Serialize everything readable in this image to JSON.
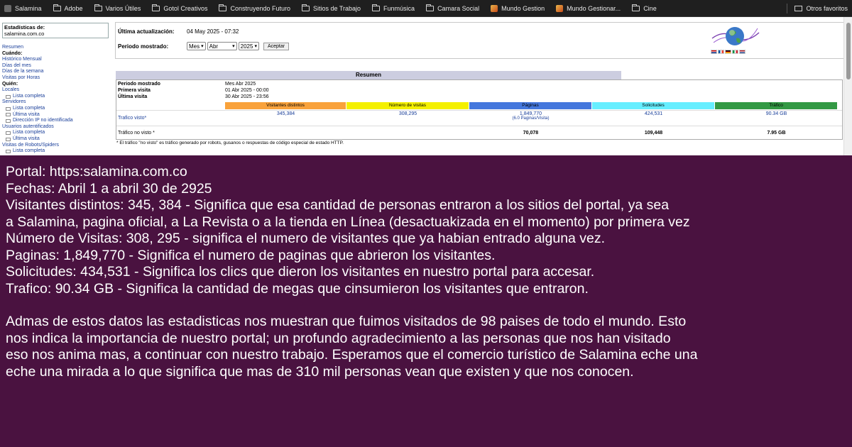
{
  "bookmarks": {
    "items": [
      {
        "label": "Salamina",
        "icon": "site-favicon"
      },
      {
        "label": "Adobe",
        "icon": "folder-icon"
      },
      {
        "label": "Varios Útiles",
        "icon": "folder-icon"
      },
      {
        "label": "Gotol Creativos",
        "icon": "folder-icon"
      },
      {
        "label": "Construyendo Futuro",
        "icon": "folder-icon"
      },
      {
        "label": "Sitios de Trabajo",
        "icon": "folder-icon"
      },
      {
        "label": "Funmúsica",
        "icon": "folder-icon"
      },
      {
        "label": "Camara Social",
        "icon": "folder-icon"
      },
      {
        "label": "Mundo Gestion",
        "icon": "site-favicon"
      },
      {
        "label": "Mundo Gestionar...",
        "icon": "site-favicon"
      },
      {
        "label": "Cine",
        "icon": "folder-icon"
      }
    ],
    "other": "Otros favoritos"
  },
  "sidebar": {
    "site_title": "Estadísticas de:",
    "site_name": "salamina.com.co",
    "resumen": "Resumen",
    "cuando": "Cuándo:",
    "historico": "Histórico Mensual",
    "dias_mes": "Días del mes",
    "dias_semana": "Días de la semana",
    "visitas_horas": "Visitas por Horas",
    "quien": "Quién:",
    "locales": "Locales",
    "lista_completa": "Lista completa",
    "servidores": "Servidores",
    "ultima_visita": "Última visita",
    "ip_no_id": "Dirección IP no identificada",
    "usuarios_aut": "Usuarios autentificados",
    "robots": "Visitas de Robots/Spiders"
  },
  "form": {
    "last_update_label": "Última actualización:",
    "last_update_value": "04 May 2025 - 07:32",
    "period_label": "Periodo mostrado:",
    "type_value": "Mes",
    "month_value": "Abr",
    "year_value": "2025",
    "accept": "Aceptar"
  },
  "stats": {
    "heading": "Resumen",
    "periodo_label": "Periodo mostrado",
    "periodo_value": "Mes Abr 2025",
    "primera_label": "Primera visita",
    "primera_value": "01 Abr 2025 - 00:00",
    "ultima_label": "Última visita",
    "ultima_value": "30 Abr 2025 - 23:56",
    "columns": [
      {
        "label": "Visitantes distintos",
        "color": "#f9a23b"
      },
      {
        "label": "Número de visitas",
        "color": "#f4f000"
      },
      {
        "label": "Páginas",
        "color": "#4477dd"
      },
      {
        "label": "Solicitudes",
        "color": "#66eeff"
      },
      {
        "label": "Tráfico",
        "color": "#339944"
      }
    ],
    "visto_label": "Trafico visto*",
    "visto": [
      "345,384",
      "308,295",
      "1,849,770",
      "424,531",
      "90.34 GB"
    ],
    "visto_note": "(6.0 Paginas/Visita)",
    "no_visto_label": "Tráfico no visto *",
    "no_visto": [
      "",
      "",
      "70,078",
      "109,448",
      "7.95 GB"
    ],
    "footnote": "* El tráfico \"no visto\" es tráfico generado por robots, gusanos o respuestas de código especial de estado HTTP."
  },
  "caption": {
    "lines": [
      "Portal: https:salamina.com.co",
      "Fechas: Abril 1 a abril 30 de 2925",
      "Visitantes distintos: 345, 384 - Significa que esa cantidad de personas entraron a los sitios del portal, ya sea",
      "a Salamina, pagina oficial, a La Revista o a la tienda en Línea (desactuakizada en el momento) por primera vez",
      "Número de Visitas: 308, 295 - significa el numero de visitantes que ya habian entrado alguna vez.",
      "Paginas: 1,849,770 - Significa el numero de paginas que abrieron los visitantes.",
      "Solicitudes:  434,531 - Significa los clics que dieron los visitantes en nuestro portal para accesar.",
      "Trafico: 90.34 GB - Significa la cantidad de megas que cinsumieron los visitantes que entraron."
    ],
    "paragraph": [
      "Admas de estos datos las estadisticas nos muestran que fuimos visitados de 98 paises de todo el mundo. Esto",
      "nos indica la importancia de nuestro portal; un profundo agradecimiento a las personas que nos han visitado",
      "eso nos anima mas, a continuar con nuestro trabajo. Esperamos que el comercio turístico de Salamina eche una",
      "eche una mirada a lo que significa que mas de 310 mil personas vean que existen y que nos conocen."
    ]
  }
}
